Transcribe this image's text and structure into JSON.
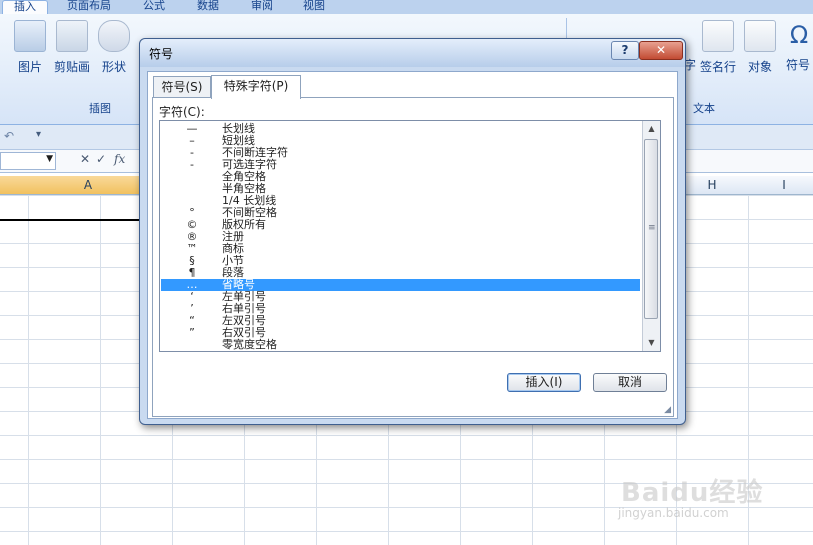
{
  "ribbon": {
    "tabs": [
      "插入",
      "页面布局",
      "公式",
      "数据",
      "审阅",
      "视图"
    ],
    "buttons": {
      "picture": "图片",
      "clipart": "剪贴画",
      "shapes": "形状",
      "text_partial": "字",
      "signature": "签名行",
      "object": "对象",
      "symbol": "符号"
    },
    "groups": {
      "illustrations": "插图",
      "text": "文本"
    }
  },
  "sheet": {
    "columns": {
      "a": "A",
      "h": "H",
      "i": "I"
    }
  },
  "dialog": {
    "title": "符号",
    "help": "?",
    "close": "✕",
    "tabs": {
      "symbols": "符号(S)",
      "special": "特殊字符(P)"
    },
    "list_label": "字符(C):",
    "rows": [
      {
        "ch": "—",
        "name": "长划线"
      },
      {
        "ch": "–",
        "name": "短划线"
      },
      {
        "ch": "-",
        "name": "不间断连字符"
      },
      {
        "ch": "-",
        "name": "可选连字符"
      },
      {
        "ch": "",
        "name": "全角空格"
      },
      {
        "ch": "",
        "name": "半角空格"
      },
      {
        "ch": "",
        "name": "1/4 长划线"
      },
      {
        "ch": "°",
        "name": "不间断空格"
      },
      {
        "ch": "©",
        "name": "版权所有"
      },
      {
        "ch": "®",
        "name": "注册"
      },
      {
        "ch": "™",
        "name": "商标"
      },
      {
        "ch": "§",
        "name": "小节"
      },
      {
        "ch": "¶",
        "name": "段落"
      },
      {
        "ch": "…",
        "name": "省略号"
      },
      {
        "ch": "‘",
        "name": "左单引号"
      },
      {
        "ch": "’",
        "name": "右单引号"
      },
      {
        "ch": "“",
        "name": "左双引号"
      },
      {
        "ch": "”",
        "name": "右双引号"
      },
      {
        "ch": "",
        "name": "零宽度空格"
      }
    ],
    "selected_index": 13,
    "insert_button": "插入(I)",
    "cancel_button": "取消"
  },
  "watermark": {
    "text": "Baidu经验",
    "sub": "jingyan.baidu.com"
  }
}
